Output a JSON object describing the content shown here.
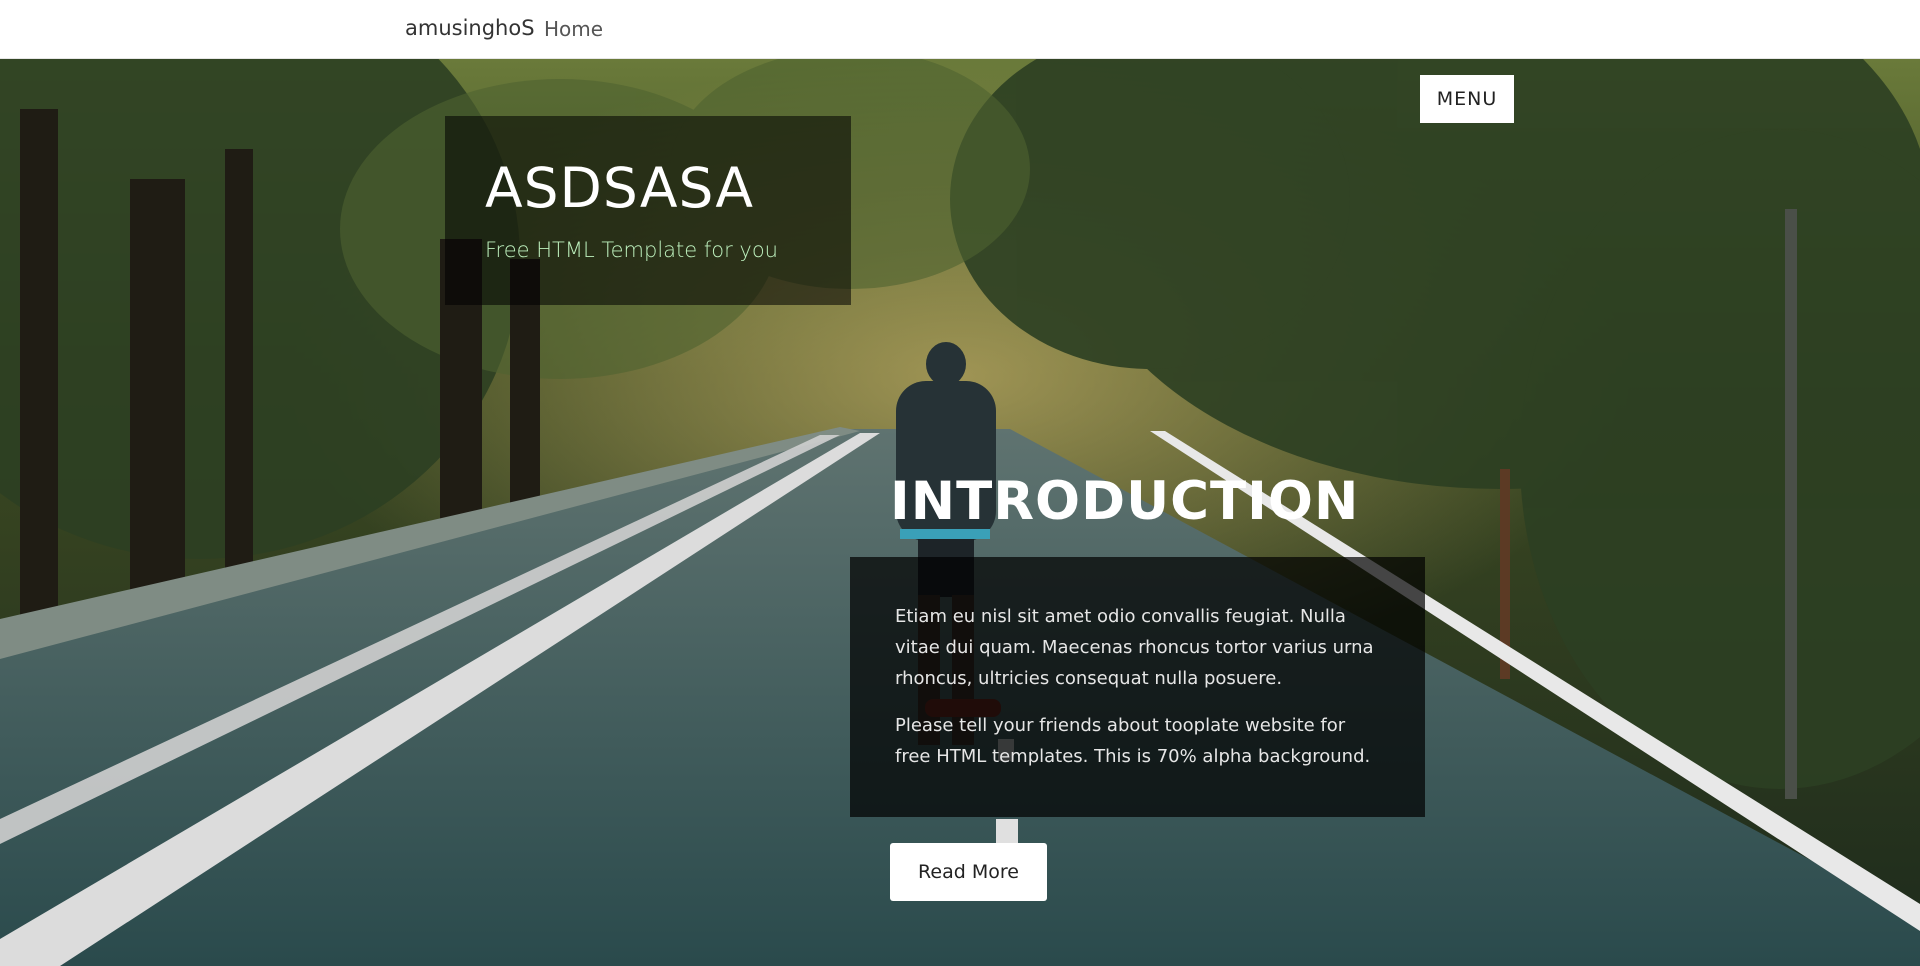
{
  "nav": {
    "brand": "amusinghoS",
    "home_label": "Home",
    "menu_label": "MENU"
  },
  "hero": {
    "site_title": "ASDSASA",
    "site_subtitle": "Free HTML Template for you",
    "intro_title": "INTRODUCTION",
    "paragraphs": [
      "Etiam eu nisl sit amet odio convallis feugiat. Nulla vitae dui quam. Maecenas rhoncus tortor varius urna rhoncus, ultricies consequat nulla posuere.",
      "Please tell your friends about tooplate website for free HTML templates. This is 70% alpha background."
    ],
    "read_more_label": "Read More"
  },
  "colors": {
    "subtitle": "#bdf0bd",
    "overlay": "#000000"
  }
}
